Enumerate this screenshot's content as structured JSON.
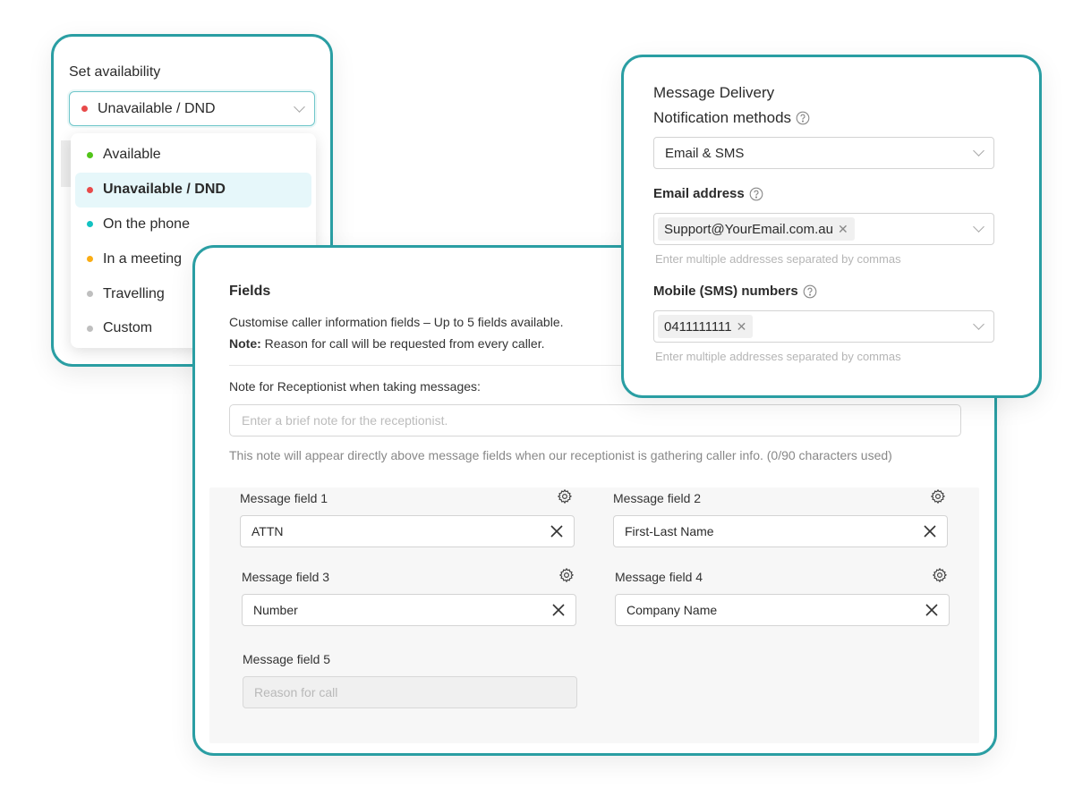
{
  "availability": {
    "title": "Set availability",
    "selected": {
      "label": "Unavailable / DND",
      "color": "#e84a4a"
    },
    "options": [
      {
        "label": "Available",
        "color": "#52c41a",
        "active": false
      },
      {
        "label": "Unavailable / DND",
        "color": "#e84a4a",
        "active": true
      },
      {
        "label": "On the phone",
        "color": "#13c2c2",
        "active": false
      },
      {
        "label": "In a meeting",
        "color": "#faad14",
        "active": false
      },
      {
        "label": "Travelling",
        "color": "#bfbfbf",
        "active": false
      },
      {
        "label": "Custom",
        "color": "#bfbfbf",
        "active": false
      }
    ]
  },
  "fields": {
    "title": "Fields",
    "description": "Customise caller information fields – Up to 5 fields available.",
    "note_prefix": "Note:",
    "note_text": " Reason for call will be requested from every caller.",
    "receptionist_label": "Note for Receptionist when taking messages:",
    "receptionist_placeholder": "Enter a brief note for the receptionist.",
    "help_text": "This note will appear directly above message fields when our receptionist is gathering caller info. (0/90 characters used)",
    "message_fields": [
      {
        "label": "Message field 1",
        "value": "ATTN"
      },
      {
        "label": "Message field 2",
        "value": "First-Last Name"
      },
      {
        "label": "Message field 3",
        "value": "Number"
      },
      {
        "label": "Message field 4",
        "value": "Company Name"
      },
      {
        "label": "Message field 5",
        "value": "Reason for call"
      }
    ]
  },
  "delivery": {
    "title": "Message Delivery",
    "methods_label": "Notification methods",
    "methods_value": "Email & SMS",
    "email_label": "Email address",
    "email_tag": "Support@YourEmail.com.au",
    "email_hint": "Enter multiple addresses separated by commas",
    "sms_label": "Mobile (SMS) numbers",
    "sms_tag": "0411111111",
    "sms_hint": "Enter multiple addresses separated by commas"
  },
  "colors": {
    "accent": "#2a9ea3",
    "active_bg": "#e6f7fa"
  },
  "icons": [
    "chevron-down-icon",
    "gear-icon",
    "close-icon",
    "help-circle-icon"
  ]
}
